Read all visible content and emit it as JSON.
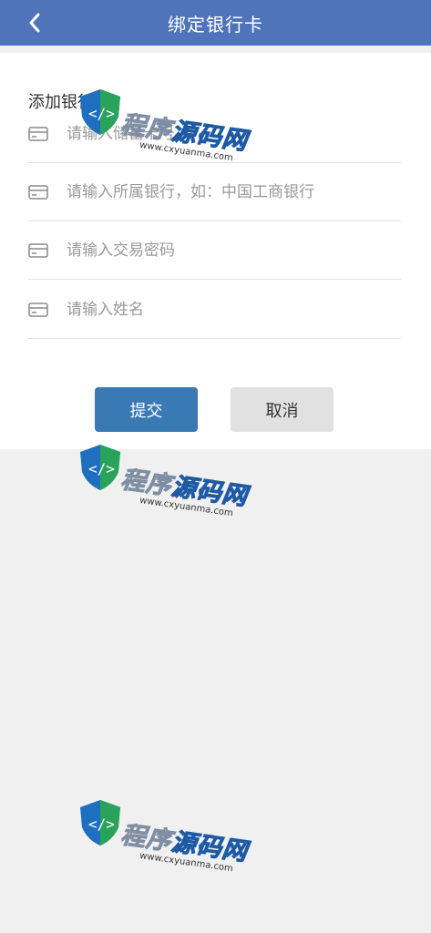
{
  "header": {
    "title": "绑定银行卡"
  },
  "section": {
    "title": "添加银行卡"
  },
  "form": {
    "fields": [
      {
        "placeholder": "请输入储蓄卡号"
      },
      {
        "placeholder": "请输入所属银行，如：中国工商银行"
      },
      {
        "placeholder": "请输入交易密码"
      },
      {
        "placeholder": "请输入姓名"
      }
    ],
    "submit_label": "提交",
    "cancel_label": "取消"
  },
  "watermark": {
    "text_gray": "程序",
    "text_blue": "源码网",
    "url": "www.cxyuanma.com"
  },
  "colors": {
    "header": "#4f74b9",
    "submit": "#3a7ab4",
    "cancel": "#e1e1e1",
    "background": "#f0f0f0"
  },
  "icons": {
    "back": "chevron-left-icon",
    "field": "card-icon"
  }
}
